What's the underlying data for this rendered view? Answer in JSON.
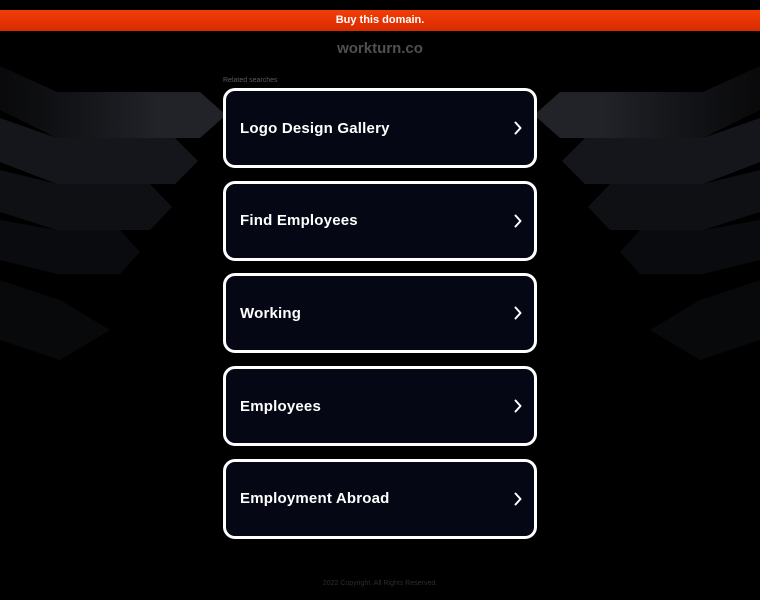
{
  "banner": {
    "buy_label": "Buy this domain."
  },
  "header": {
    "domain": "workturn.co"
  },
  "related": {
    "label": "Related searches",
    "items": [
      {
        "label": "Logo Design Gallery"
      },
      {
        "label": "Find Employees"
      },
      {
        "label": "Working"
      },
      {
        "label": "Employees"
      },
      {
        "label": "Employment Abroad"
      }
    ]
  },
  "footer": {
    "text": "2022 Copyright. All Rights Reserved."
  },
  "colors": {
    "background": "#000000",
    "banner": "#e93200",
    "card_background": "#050814",
    "card_border": "#ffffff"
  },
  "icons": {
    "link_arrow": "chevron-right-icon"
  }
}
